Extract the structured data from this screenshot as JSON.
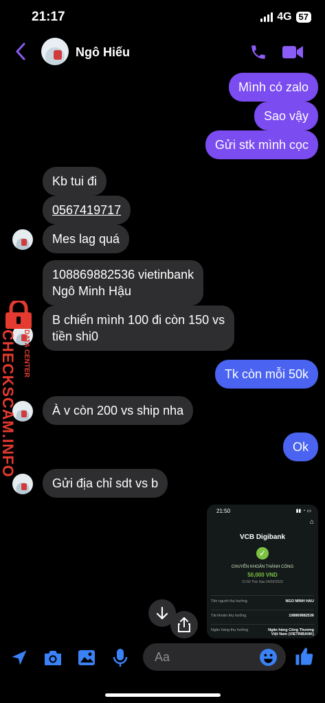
{
  "status_bar": {
    "time": "21:17",
    "network": "4G",
    "battery": "57"
  },
  "header": {
    "contact_name": "Ngô Hiếu"
  },
  "messages": {
    "out_1": "Mình có zalo",
    "out_2": "Sao vậy",
    "out_3": "Gửi stk mình cọc",
    "in_1": "Kb tui đi",
    "in_2": "0567419717",
    "in_3": "Mes lag quá",
    "in_4_line1": "108869882536 vietinbank",
    "in_4_line2": "Ngô Minh Hậu",
    "in_5_line1": "B chiển mình 100 đi còn 150 vs",
    "in_5_line2": "tiền shi0",
    "out_4": "Tk còn mỗi 50k",
    "in_6": "À v còn 200 vs ship nha",
    "out_5": "Ok",
    "in_7": "Gửi địa chỉ sdt vs b"
  },
  "watermark": {
    "main": "CHECKSCAM.INFO",
    "sub": "DATA CENTER"
  },
  "receipt": {
    "time": "21:50",
    "brand": "VCB Digibank",
    "status": "CHUYỂN KHOẢN THÀNH CÔNG",
    "amount": "50,000 VND",
    "date": "21:50 Thứ Sáu 24/03/2023",
    "rows": [
      {
        "label": "Tên người thụ hưởng",
        "value": "NGO MINH HAU"
      },
      {
        "label": "Tài khoản thụ hưởng",
        "value": "108869882536"
      },
      {
        "label": "Ngân hàng thụ hưởng",
        "value": "Ngân hàng Công Thương Việt Nam (VIETINBANK)"
      }
    ]
  },
  "composer": {
    "placeholder": "Aa"
  },
  "colors": {
    "accent": "#7b4cf0",
    "toolbar_blue": "#3b82f6",
    "incoming": "#2e2e30"
  },
  "icons": [
    "back-icon",
    "phone-icon",
    "video-icon",
    "scroll-down-icon",
    "share-icon",
    "send-location-icon",
    "camera-icon",
    "gallery-icon",
    "mic-icon",
    "emoji-icon",
    "like-icon"
  ]
}
